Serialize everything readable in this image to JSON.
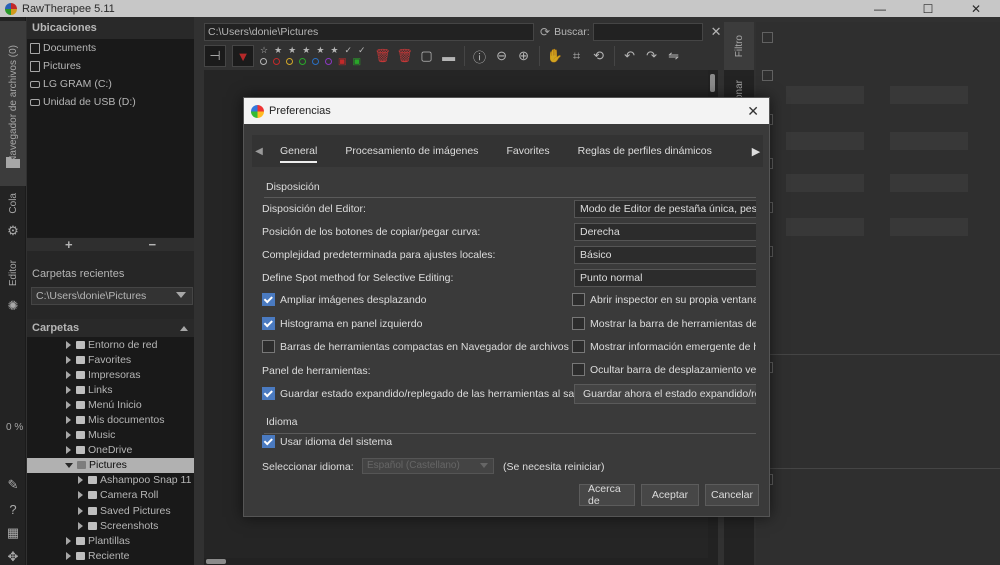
{
  "window": {
    "title": "RawTherapee 5.11",
    "controls": [
      "—",
      "☐",
      "✕"
    ]
  },
  "left_tabs": {
    "file_browser": "Navegador de archivos (0)",
    "queue": "Cola",
    "editor": "Editor",
    "progress": "0 %"
  },
  "locations": {
    "header": "Ubicaciones",
    "items": [
      {
        "label": "Documents",
        "icon": "file-icon"
      },
      {
        "label": "Pictures",
        "icon": "file-icon"
      },
      {
        "label": "LG GRAM (C:)",
        "icon": "drive-icon"
      },
      {
        "label": "Unidad de USB (D:)",
        "icon": "drive-icon"
      }
    ],
    "add": "+",
    "remove": "−"
  },
  "recent": {
    "label": "Carpetas recientes",
    "value": "C:\\Users\\donie\\Pictures"
  },
  "folders": {
    "header": "Carpetas",
    "items": [
      {
        "label": "Entorno de red",
        "level": 1
      },
      {
        "label": "Favorites",
        "level": 1
      },
      {
        "label": "Impresoras",
        "level": 1
      },
      {
        "label": "Links",
        "level": 1
      },
      {
        "label": "Menú Inicio",
        "level": 1
      },
      {
        "label": "Mis documentos",
        "level": 1
      },
      {
        "label": "Music",
        "level": 1
      },
      {
        "label": "OneDrive",
        "level": 1
      },
      {
        "label": "Pictures",
        "level": 1,
        "expanded": true,
        "selected": true
      },
      {
        "label": "Ashampoo Snap 11",
        "level": 2
      },
      {
        "label": "Camera Roll",
        "level": 2
      },
      {
        "label": "Saved Pictures",
        "level": 2
      },
      {
        "label": "Screenshots",
        "level": 2
      },
      {
        "label": "Plantillas",
        "level": 1
      },
      {
        "label": "Reciente",
        "level": 1
      }
    ]
  },
  "pathbar": {
    "path": "C:\\Users\\donie\\Pictures",
    "search_label": "Buscar:",
    "clear": "✕"
  },
  "right_tabs": {
    "filter": "Filtro",
    "inspect": "ionar"
  },
  "dialog": {
    "title": "Preferencias",
    "close": "✕",
    "tabs": [
      "General",
      "Procesamiento de imágenes",
      "Favorites",
      "Reglas de perfiles dinámicos"
    ],
    "active_tab": "General",
    "disposicion": {
      "title": "Disposición",
      "editor_layout_label": "Disposición del Editor:",
      "editor_layout_value": "Modo de Editor de pestaña única, pestañas verticales",
      "curve_buttons_label": "Posición de los botones de copiar/pegar curva:",
      "curve_buttons_value": "Derecha",
      "complexity_label": "Complejidad predeterminada para ajustes locales:",
      "complexity_value": "Básico",
      "spot_label": "Define Spot method for Selective Editing:",
      "spot_value": "Punto normal",
      "zoom_pan": {
        "label": "Ampliar imágenes desplazando",
        "checked": true
      },
      "open_inspector": {
        "label": "Abrir inspector en su propia ventana o pantalla",
        "checked": false
      },
      "histogram_left": {
        "label": "Histograma en panel izquierdo",
        "checked": true
      },
      "show_toolbar": {
        "label": "Mostrar la barra de herramientas de la vista",
        "checked": false
      },
      "compact_toolbars": {
        "label": "Barras de herramientas compactas en Navegador de archivos",
        "checked": false
      },
      "show_tooltips": {
        "label": "Mostrar información emergente de herramientas",
        "checked": false
      },
      "tools_panel_label": "Panel de herramientas:",
      "hide_scrollbar": {
        "label": "Ocultar barra de desplazamiento vertical",
        "checked": false
      },
      "save_expanded": {
        "label": "Guardar estado expandido/replegado de las herramientas al salir",
        "checked": true
      },
      "save_now_button": "Guardar ahora el estado expandido/replegado"
    },
    "idioma": {
      "title": "Idioma",
      "use_system": {
        "label": "Usar idioma del sistema",
        "checked": true
      },
      "select_label": "Seleccionar idioma:",
      "select_value": "Español (Castellano)",
      "restart_note": "(Se necesita reiniciar)"
    },
    "buttons": {
      "about": "Acerca de",
      "ok": "Aceptar",
      "cancel": "Cancelar"
    }
  }
}
